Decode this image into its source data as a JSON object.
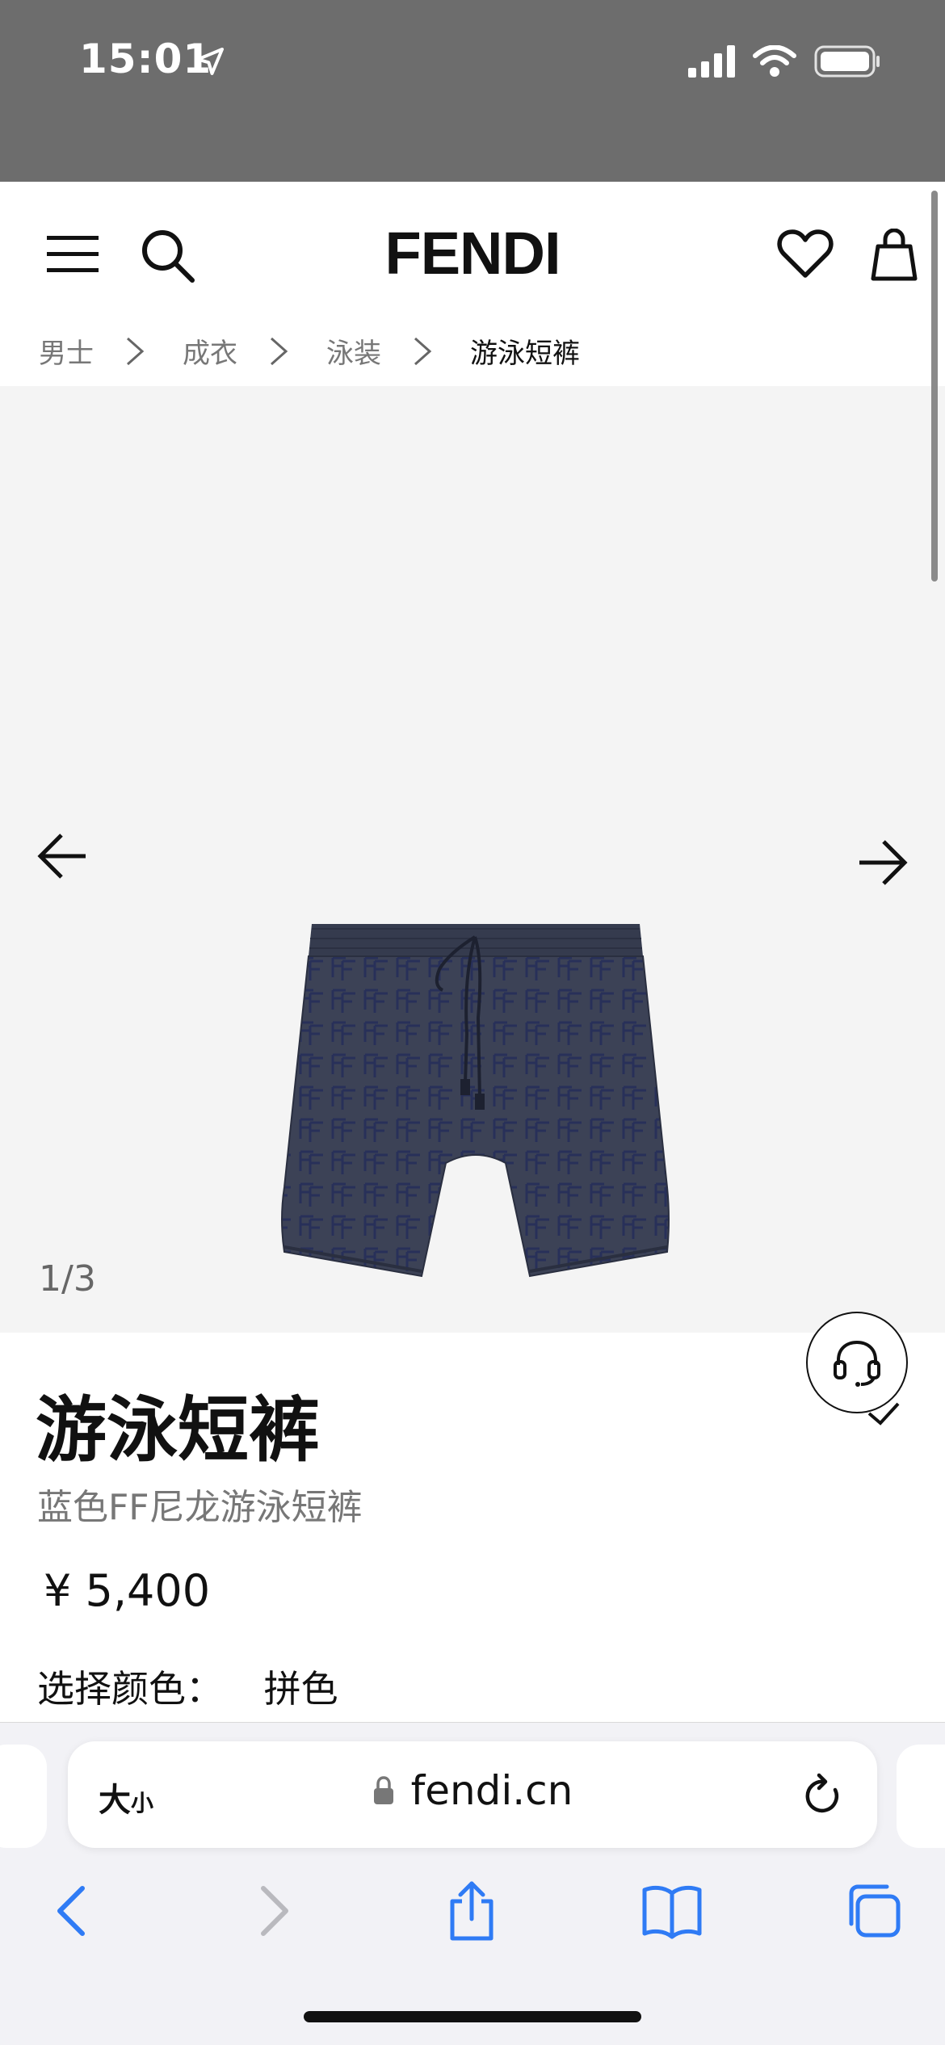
{
  "status_bar": {
    "time": "15:01"
  },
  "header": {
    "logo": "FENDI"
  },
  "breadcrumb": {
    "items": [
      "男士",
      "成衣",
      "泳装",
      "游泳短裤"
    ]
  },
  "gallery": {
    "counter": "1/3",
    "image_subject": "navy FF pattern swim shorts"
  },
  "product": {
    "title": "游泳短裤",
    "subtitle": "蓝色FF尼龙游泳短裤",
    "price": "¥  5,400",
    "color_label": "选择颜色：",
    "color_value": "拼色"
  },
  "safari": {
    "text_size_big": "大",
    "text_size_small": "小",
    "url": "fendi.cn"
  },
  "icons": {
    "menu": "menu-icon",
    "search": "search-icon",
    "heart": "heart-icon",
    "bag": "bag-icon",
    "chat": "headset-icon"
  },
  "colors": {
    "status_bar_bg": "#6d6d6d",
    "gallery_bg": "#f4f4f4",
    "safari_accent": "#2f7bf5",
    "shorts_navy": "#3a4156"
  }
}
